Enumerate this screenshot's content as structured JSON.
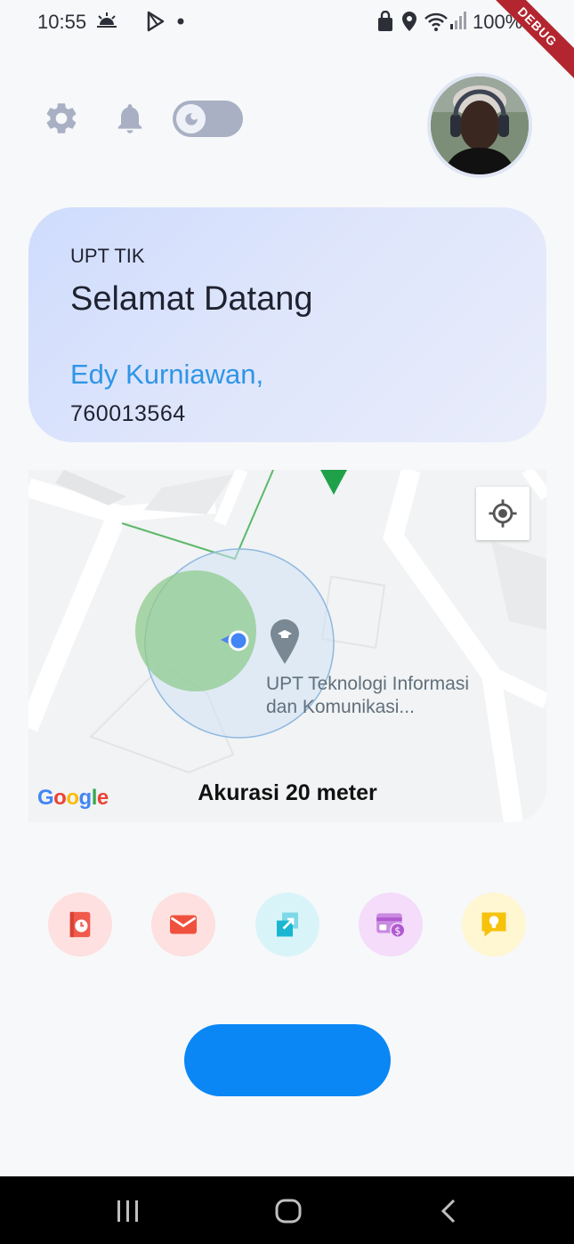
{
  "status_bar": {
    "time": "10:55",
    "battery": "100%",
    "debug_label": "DEBUG"
  },
  "welcome": {
    "org": "UPT TIK",
    "greeting": "Selamat Datang",
    "user_name": "Edy Kurniawan,",
    "user_id": "760013564"
  },
  "map": {
    "poi_line1": "UPT Teknologi Informasi",
    "poi_line2": "dan Komunikasi...",
    "accuracy": "Akurasi 20 meter",
    "google": "Google"
  },
  "menu": {
    "items": [
      {
        "icon": "book-clock-icon",
        "bg": "#fde0df",
        "color": "#f05a4c",
        "caption": ""
      },
      {
        "icon": "mail-icon",
        "bg": "#fde0df",
        "color": "#f0513e",
        "caption": ""
      },
      {
        "icon": "swap-arrows-icon",
        "bg": "#d9f4f8",
        "color": "#19b6d2",
        "caption": ""
      },
      {
        "icon": "money-card-icon",
        "bg": "#f4dcfa",
        "color": "#b25ad1",
        "caption": ""
      },
      {
        "icon": "idea-bubble-icon",
        "bg": "#fff6d2",
        "color": "#f6c20b",
        "caption": ""
      }
    ]
  },
  "colors": {
    "accent": "#0a87f5",
    "name_blue": "#2f95e6",
    "icon_gray": "#a9b0c4"
  }
}
